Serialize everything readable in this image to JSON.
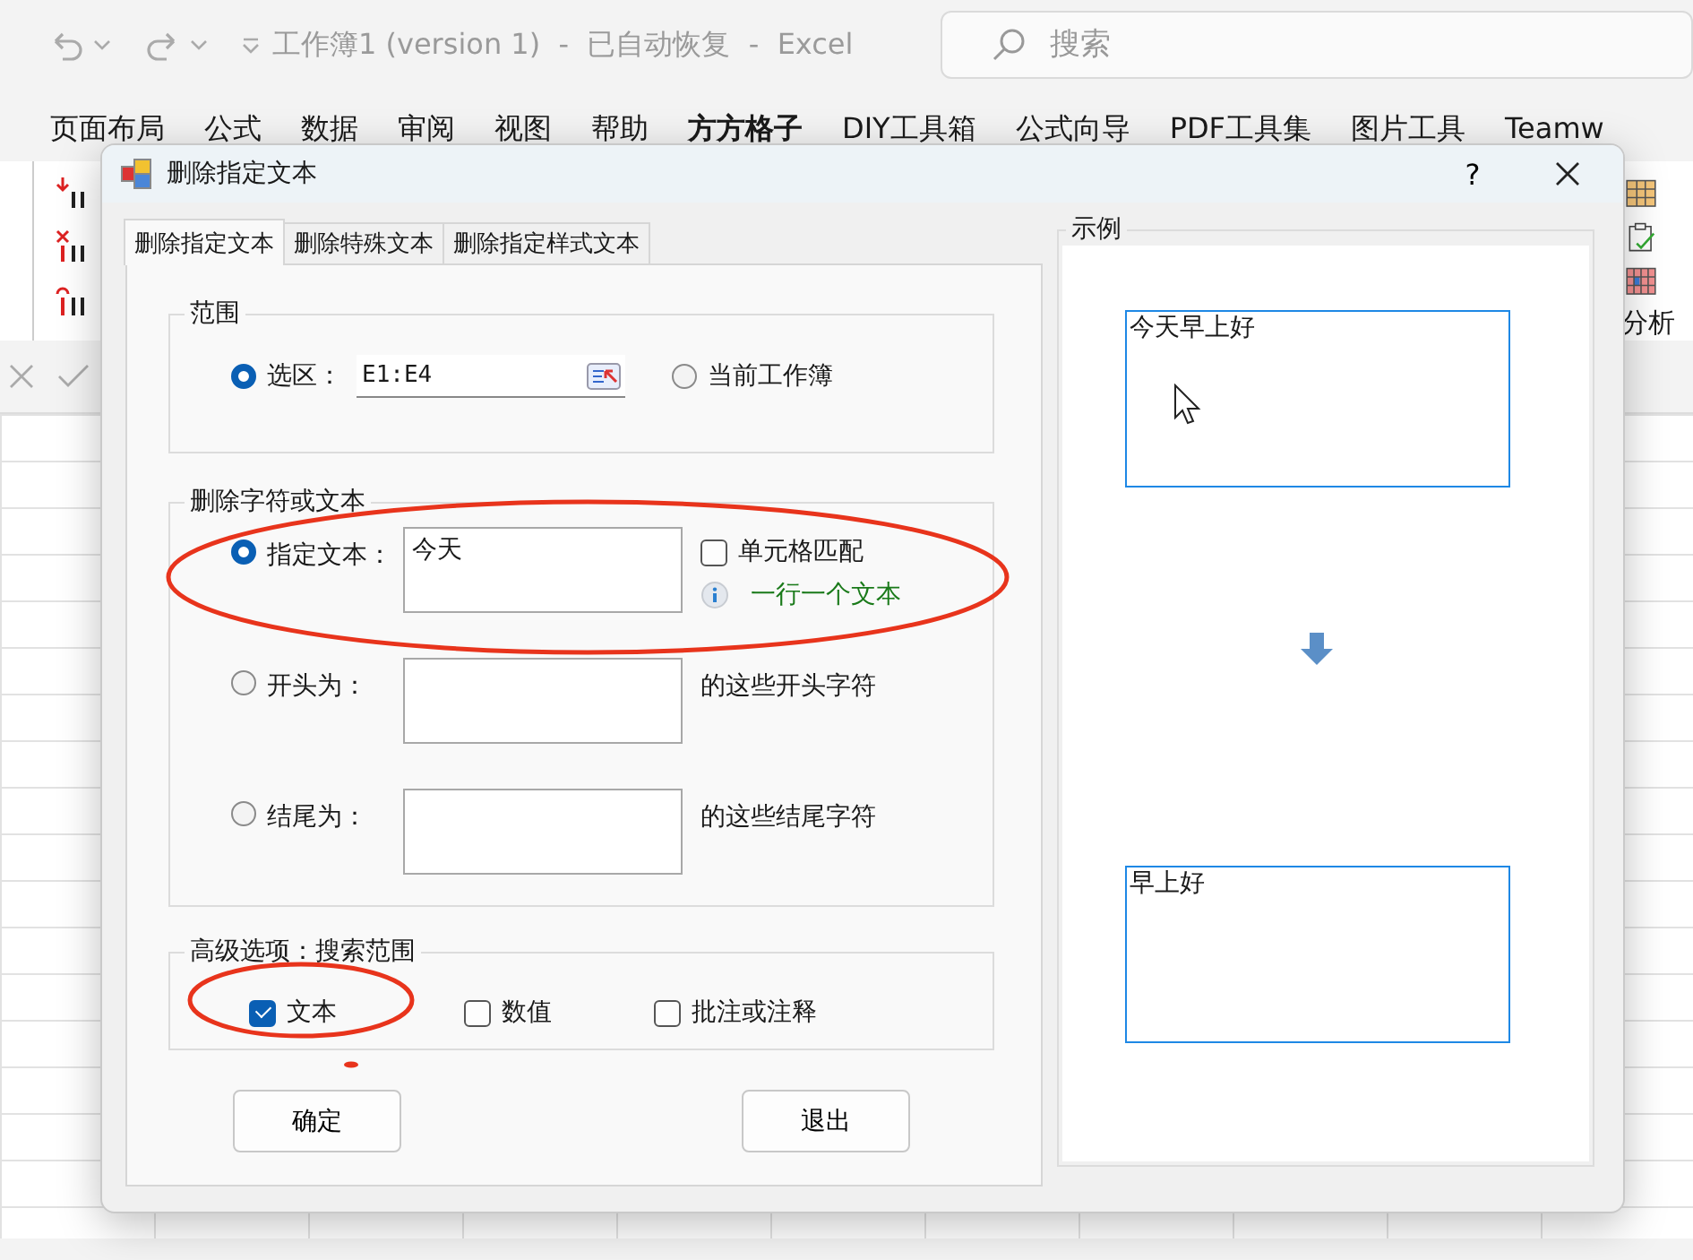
{
  "app": {
    "title": "工作簿1 (version 1)  -  已自动恢复  -  Excel",
    "search": {
      "placeholder": "搜索"
    }
  },
  "ribbon_tabs": [
    {
      "label": "页面布局",
      "selected": false
    },
    {
      "label": "公式",
      "selected": false
    },
    {
      "label": "数据",
      "selected": false
    },
    {
      "label": "审阅",
      "selected": false
    },
    {
      "label": "视图",
      "selected": false
    },
    {
      "label": "帮助",
      "selected": false
    },
    {
      "label": "方方格子",
      "selected": true
    },
    {
      "label": "DIY工具箱",
      "selected": false
    },
    {
      "label": "公式向导",
      "selected": false
    },
    {
      "label": "PDF工具集",
      "selected": false
    },
    {
      "label": "图片工具",
      "selected": false
    },
    {
      "label": "Teamw",
      "selected": false
    }
  ],
  "ribbon": {
    "group_label": "分析"
  },
  "dialog": {
    "title": "删除指定文本",
    "help": "?",
    "tabs": [
      {
        "label": "删除指定文本",
        "selected": true
      },
      {
        "label": "删除特殊文本",
        "selected": false
      },
      {
        "label": "删除指定样式文本",
        "selected": false
      }
    ],
    "range": {
      "legend": "范围",
      "options": [
        {
          "label": "选区：",
          "selected": true,
          "value": "E1:E4"
        },
        {
          "label": "当前工作簿",
          "selected": false
        }
      ]
    },
    "delete": {
      "legend": "删除字符或文本",
      "rows": [
        {
          "label": "指定文本：",
          "selected": true,
          "value": "今天",
          "option": {
            "label": "单元格匹配",
            "checked": false
          },
          "hint": "一行一个文本"
        },
        {
          "label": "开头为：",
          "selected": false,
          "note": "的这些开头字符"
        },
        {
          "label": "结尾为：",
          "selected": false,
          "note": "的这些结尾字符"
        }
      ]
    },
    "advanced": {
      "legend": "高级选项：搜索范围",
      "checks": [
        {
          "label": "文本",
          "checked": true
        },
        {
          "label": "数值",
          "checked": false
        },
        {
          "label": "批注或注释",
          "checked": false
        }
      ]
    },
    "buttons": [
      "确定",
      "退出"
    ],
    "example": {
      "legend": "示例",
      "before": "今天早上好",
      "after": "早上好"
    }
  }
}
